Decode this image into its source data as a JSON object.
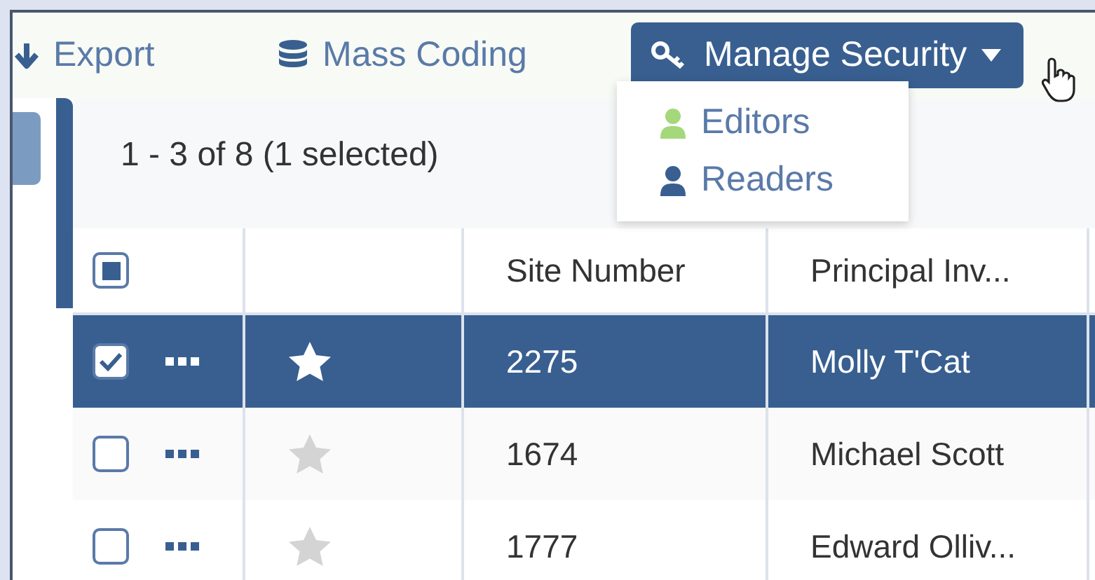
{
  "toolbar": [
    {
      "label": "Export",
      "kind": "link"
    },
    {
      "label": "Mass Coding",
      "kind": "link"
    },
    {
      "label": "Manage Security",
      "kind": "dropdown",
      "expanded": true
    }
  ],
  "security_menu": [
    {
      "label": "Editors",
      "color": "#a5d77b"
    },
    {
      "label": "Readers",
      "color": "#385f90"
    }
  ],
  "result_count": "1 - 3 of 8 (1 selected)",
  "table": {
    "select_all": {
      "partial": true
    },
    "columns": [
      "Site Number",
      "Principal Inv..."
    ],
    "rows": [
      {
        "selected": true,
        "starred": true,
        "cells": [
          "2275",
          "Molly T'Cat"
        ]
      },
      {
        "selected": false,
        "starred": false,
        "cells": [
          "1674",
          "Michael Scott"
        ]
      },
      {
        "selected": false,
        "starred": false,
        "cells": [
          "1777",
          "Edward Olliv..."
        ]
      }
    ]
  }
}
